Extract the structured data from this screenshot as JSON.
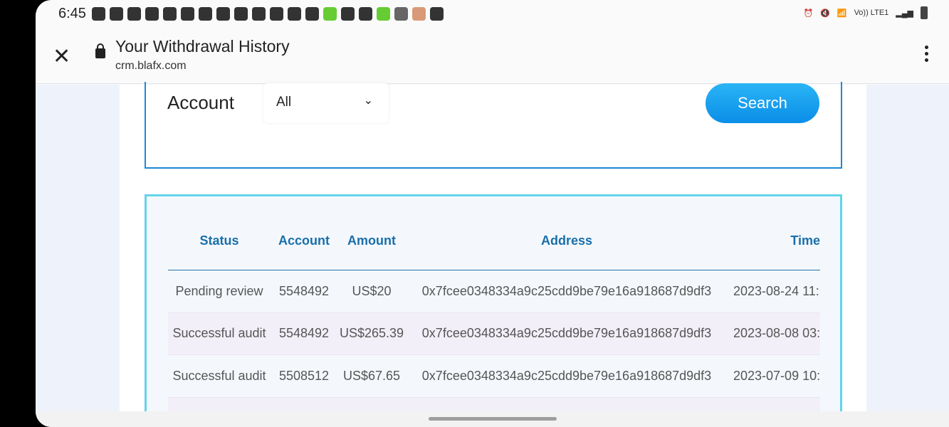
{
  "status_bar": {
    "time": "6:45",
    "network": "Vo)) LTE1"
  },
  "browser": {
    "title": "Your Withdrawal History",
    "url": "crm.blafx.com"
  },
  "filter": {
    "account_label": "Account",
    "account_value": "All",
    "search_label": "Search"
  },
  "table": {
    "headers": [
      "Status",
      "Account",
      "Amount",
      "Address",
      "Time"
    ],
    "rows": [
      [
        "Pending review",
        "5548492",
        "US$20",
        "0x7fcee0348334a9c25cdd9be79e16a918687d9df3",
        "2023-08-24 11:"
      ],
      [
        "Successful audit",
        "5548492",
        "US$265.39",
        "0x7fcee0348334a9c25cdd9be79e16a918687d9df3",
        "2023-08-08 03:"
      ],
      [
        "Successful audit",
        "5508512",
        "US$67.65",
        "0x7fcee0348334a9c25cdd9be79e16a918687d9df3",
        "2023-07-09 10:"
      ]
    ]
  }
}
